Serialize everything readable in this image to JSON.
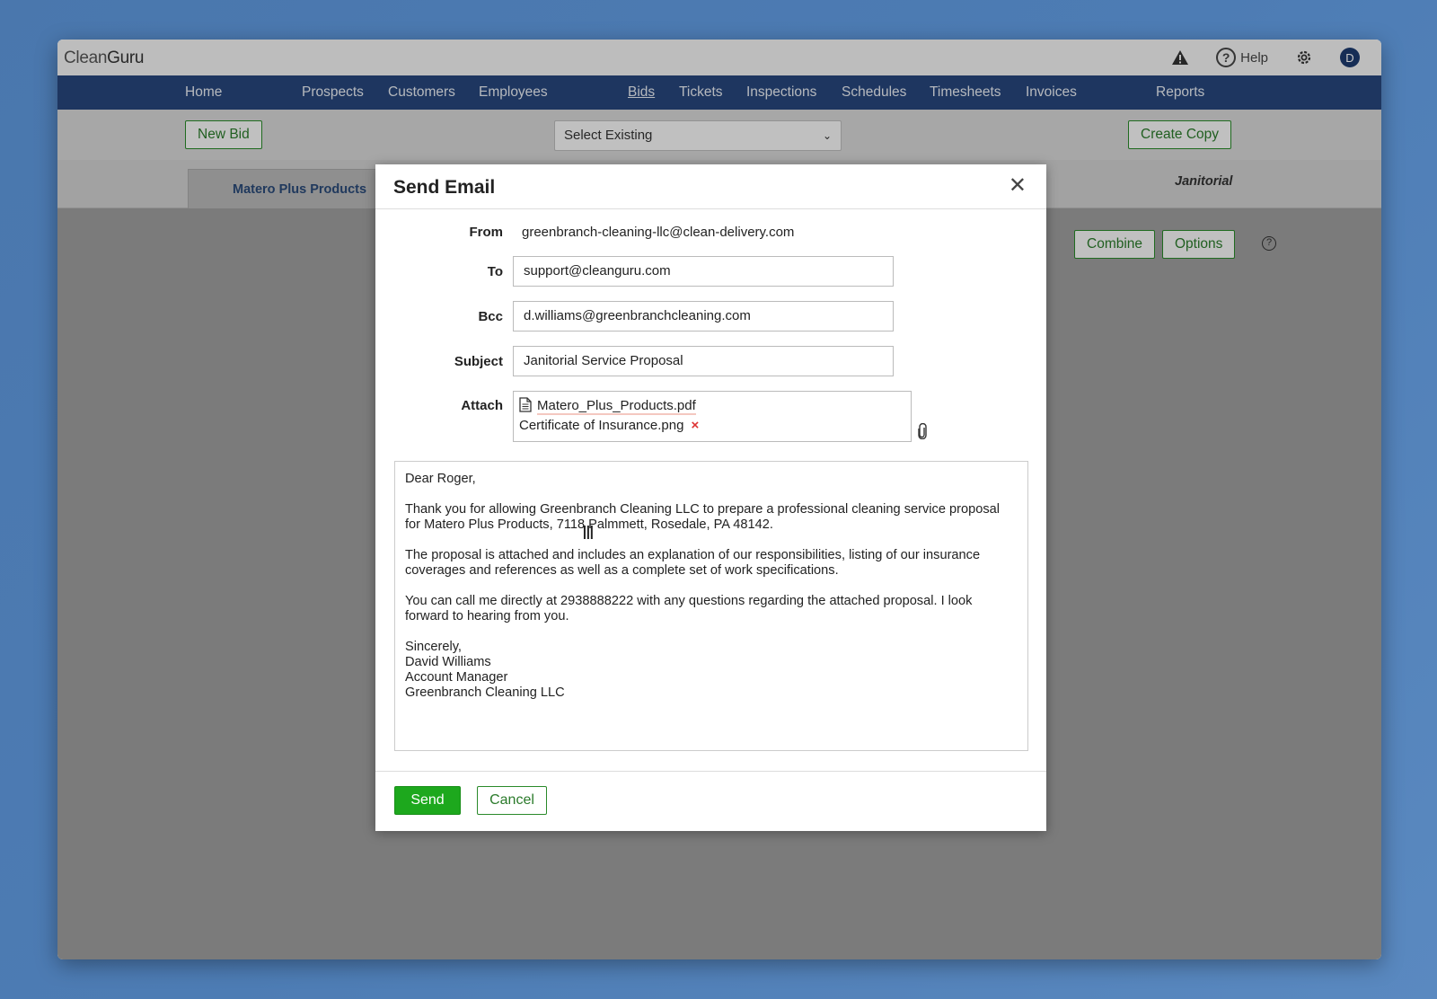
{
  "app": {
    "logo_a": "Clean",
    "logo_b": "Guru",
    "help_label": "Help",
    "avatar_initial": "D"
  },
  "nav": {
    "items": [
      "Home",
      "Prospects",
      "Customers",
      "Employees",
      "Bids",
      "Tickets",
      "Inspections",
      "Schedules",
      "Timesheets",
      "Invoices",
      "Reports"
    ],
    "active": "Bids"
  },
  "toolbar": {
    "new_bid": "New Bid",
    "select_existing": "Select Existing",
    "create_copy": "Create Copy"
  },
  "tabs": {
    "active_tab": "Matero Plus Products",
    "right_label": "Janitorial"
  },
  "content": {
    "combine": "Combine",
    "options": "Options"
  },
  "modal": {
    "title": "Send Email",
    "from_label": "From",
    "from_value": "greenbranch-cleaning-llc@clean-delivery.com",
    "to_label": "To",
    "to_value": "support@cleanguru.com",
    "bcc_label": "Bcc",
    "bcc_value": "d.williams@greenbranchcleaning.com",
    "subject_label": "Subject",
    "subject_value": "Janitorial Service Proposal",
    "attach_label": "Attach",
    "attachments": [
      "Matero_Plus_Products.pdf",
      "Certificate of Insurance.png"
    ],
    "body": {
      "greeting": "Dear Roger,",
      "p1": "Thank you for allowing Greenbranch Cleaning LLC to prepare a professional cleaning service proposal for Matero Plus Products, 7118 Palmmett, Rosedale, PA 48142.",
      "p2": "The proposal is attached and includes an explanation of our responsibilities, listing of our insurance coverages and references as well as a complete set of work specifications.",
      "p3": "You can call me directly at 2938888222 with any questions regarding the attached proposal.  I look forward to hearing from you.",
      "sig1": "Sincerely,",
      "sig2": "David Williams",
      "sig3": "Account Manager",
      "sig4": "Greenbranch Cleaning LLC"
    },
    "send": "Send",
    "cancel": "Cancel"
  },
  "colors": {
    "navbar": "#27467c",
    "send_green": "#1da81d",
    "outline_green": "#2a8a2a",
    "background": "#4d7cb4"
  },
  "icons": [
    "warning-icon",
    "help-icon",
    "gear-icon",
    "close-icon",
    "file-icon",
    "remove-icon",
    "paperclip-icon",
    "chevron-down-icon",
    "question-icon"
  ]
}
